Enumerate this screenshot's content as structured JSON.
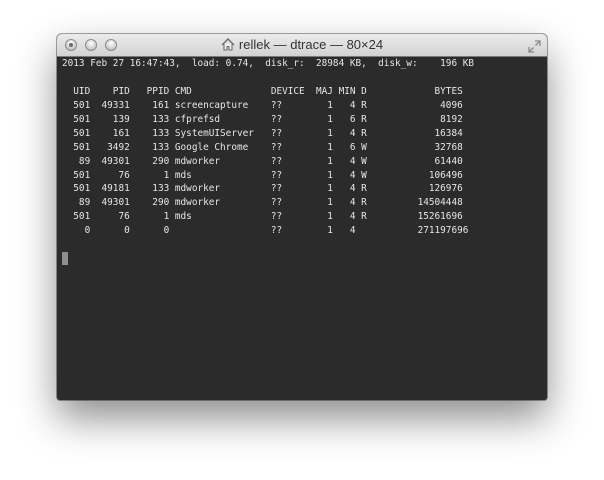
{
  "window": {
    "title": "rellek — dtrace — 80×24",
    "status_line": "2013 Feb 27 16:47:43,  load: 0.74,  disk_r:  28984 KB,  disk_w:    196 KB",
    "header_line": "  UID    PID   PPID CMD              DEVICE  MAJ MIN D            BYTES",
    "rows": [
      "  501  49331    161 screencapture    ??        1   4 R             4096",
      "  501    139    133 cfprefsd         ??        1   6 R             8192",
      "  501    161    133 SystemUIServer   ??        1   4 R            16384",
      "  501   3492    133 Google Chrome    ??        1   6 W            32768",
      "   89  49301    290 mdworker         ??        1   4 W            61440",
      "  501     76      1 mds              ??        1   4 W           106496",
      "  501  49181    133 mdworker         ??        1   4 R           126976",
      "   89  49301    290 mdworker         ??        1   4 R         14504448",
      "  501     76      1 mds              ??        1   4 R         15261696",
      "    0      0      0                  ??        1   4           271197696"
    ]
  },
  "icons": [
    "home-icon",
    "resize-icon"
  ]
}
